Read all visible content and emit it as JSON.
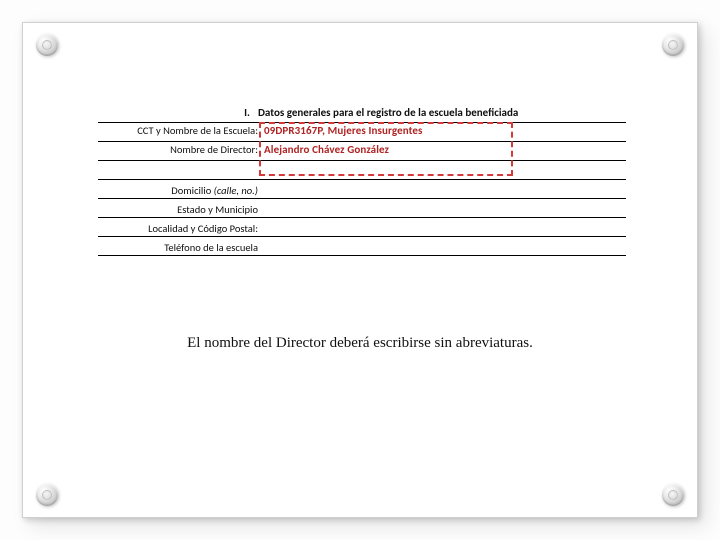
{
  "section": {
    "roman": "I.",
    "title": "Datos generales para el registro de la escuela beneficiada"
  },
  "rows": {
    "cct_label": "CCT y Nombre de la Escuela:",
    "cct_value": "09DPR3167P, Mujeres Insurgentes",
    "director_label": "Nombre de Director:",
    "director_value": "Alejandro Chávez González",
    "domicilio_label_prefix": "Domicilio ",
    "domicilio_label_italic": "(calle, no.)",
    "estado_label": "Estado y Municipio",
    "localidad_label": "Localidad y Código Postal:",
    "telefono_label": "Teléfono de la escuela"
  },
  "caption": "El nombre del Director deberá escribirse sin abreviaturas."
}
